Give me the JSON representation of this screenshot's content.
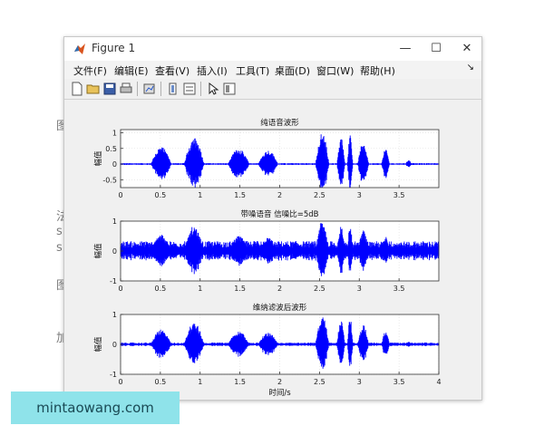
{
  "window": {
    "title": "Figure 1",
    "minimize": "—",
    "maximize": "☐",
    "close": "✕"
  },
  "menu": [
    {
      "id": "file",
      "label": "文件(F)"
    },
    {
      "id": "edit",
      "label": "编辑(E)"
    },
    {
      "id": "view",
      "label": "查看(V)"
    },
    {
      "id": "insert",
      "label": "插入(I)"
    },
    {
      "id": "tools",
      "label": "工具(T)"
    },
    {
      "id": "desktop",
      "label": "桌面(D)"
    },
    {
      "id": "window",
      "label": "窗口(W)"
    },
    {
      "id": "help",
      "label": "帮助(H)"
    }
  ],
  "menu_arrow": "↘",
  "toolbar": {
    "buttons": [
      "new-figure-icon",
      "open-folder-icon",
      "save-icon",
      "print-icon",
      "link-plot-icon",
      "colorbar-icon",
      "legend-icon",
      "pointer-icon",
      "property-inspector-icon"
    ]
  },
  "background_fragments": [
    "图",
    "法",
    "s",
    "s",
    "图",
    "加"
  ],
  "watermark": "mintaowang.com",
  "colors": {
    "signal": "#0000ff",
    "axes": "#333333",
    "grid": "#dddddd",
    "plot_bg": "#ffffff",
    "figure_bg": "#f0f0f0"
  },
  "chart_data": [
    {
      "type": "line",
      "title": "纯语音波形",
      "xlabel": "",
      "ylabel": "幅值",
      "xlim": [
        0,
        4
      ],
      "ylim": [
        -0.75,
        1.1
      ],
      "xticks": [
        0,
        0.5,
        1,
        1.5,
        2,
        2.5,
        3,
        3.5
      ],
      "xtick_labels": [
        "0",
        "0.5",
        "1",
        "1.5",
        "2",
        "2.5",
        "3",
        "3.5"
      ],
      "yticks": [
        -0.5,
        0,
        0.5,
        1
      ],
      "ytick_labels": [
        "-0.5",
        "0",
        "0.5",
        "1"
      ],
      "noise_floor": 0.02,
      "segments": [
        {
          "x": [
            0.38,
            0.64
          ],
          "amp": 0.55
        },
        {
          "x": [
            0.8,
            1.05
          ],
          "amp": 0.85
        },
        {
          "x": [
            1.35,
            1.62
          ],
          "amp": 0.5
        },
        {
          "x": [
            1.73,
            1.98
          ],
          "amp": 0.45
        },
        {
          "x": [
            2.45,
            2.62
          ],
          "amp": 1.0
        },
        {
          "x": [
            2.72,
            2.82
          ],
          "amp": 0.85
        },
        {
          "x": [
            2.85,
            2.92
          ],
          "amp": 0.95
        },
        {
          "x": [
            2.98,
            3.12
          ],
          "amp": 0.7
        },
        {
          "x": [
            3.28,
            3.38
          ],
          "amp": 0.5
        },
        {
          "x": [
            3.58,
            3.66
          ],
          "amp": 0.12
        }
      ]
    },
    {
      "type": "line",
      "title": "带噪语音 信噪比=5dB",
      "xlabel": "",
      "ylabel": "幅值",
      "xlim": [
        0,
        4
      ],
      "ylim": [
        -1,
        1
      ],
      "xticks": [
        0,
        0.5,
        1,
        1.5,
        2,
        2.5,
        3,
        3.5
      ],
      "xtick_labels": [
        "0",
        "0.5",
        "1",
        "1.5",
        "2",
        "2.5",
        "3",
        "3.5"
      ],
      "yticks": [
        -1,
        0,
        1
      ],
      "ytick_labels": [
        "-1",
        "0",
        "1"
      ],
      "noise_floor": 0.22,
      "segments": [
        {
          "x": [
            0.38,
            0.64
          ],
          "amp": 0.55
        },
        {
          "x": [
            0.8,
            1.05
          ],
          "amp": 0.85
        },
        {
          "x": [
            1.35,
            1.62
          ],
          "amp": 0.5
        },
        {
          "x": [
            1.73,
            1.98
          ],
          "amp": 0.45
        },
        {
          "x": [
            2.45,
            2.62
          ],
          "amp": 1.0
        },
        {
          "x": [
            2.72,
            2.82
          ],
          "amp": 0.85
        },
        {
          "x": [
            2.85,
            2.92
          ],
          "amp": 0.95
        },
        {
          "x": [
            2.98,
            3.12
          ],
          "amp": 0.7
        },
        {
          "x": [
            3.28,
            3.38
          ],
          "amp": 0.5
        },
        {
          "x": [
            3.58,
            3.66
          ],
          "amp": 0.12
        }
      ]
    },
    {
      "type": "line",
      "title": "维纳滤波后波形",
      "xlabel": "时间/s",
      "ylabel": "幅值",
      "xlim": [
        0,
        4
      ],
      "ylim": [
        -1,
        1
      ],
      "xticks": [
        0,
        0.5,
        1,
        1.5,
        2,
        2.5,
        3,
        3.5,
        4
      ],
      "xtick_labels": [
        "0",
        "0.5",
        "1",
        "1.5",
        "2",
        "2.5",
        "3",
        "3.5",
        "4"
      ],
      "yticks": [
        -1,
        0,
        1
      ],
      "ytick_labels": [
        "-1",
        "0",
        "1"
      ],
      "noise_floor": 0.04,
      "segments": [
        {
          "x": [
            0.38,
            0.64
          ],
          "amp": 0.5
        },
        {
          "x": [
            0.8,
            1.05
          ],
          "amp": 0.75
        },
        {
          "x": [
            1.35,
            1.62
          ],
          "amp": 0.45
        },
        {
          "x": [
            1.73,
            1.98
          ],
          "amp": 0.4
        },
        {
          "x": [
            2.45,
            2.62
          ],
          "amp": 0.95
        },
        {
          "x": [
            2.72,
            2.82
          ],
          "amp": 0.8
        },
        {
          "x": [
            2.85,
            2.92
          ],
          "amp": 0.9
        },
        {
          "x": [
            2.98,
            3.12
          ],
          "amp": 0.65
        },
        {
          "x": [
            3.28,
            3.38
          ],
          "amp": 0.45
        },
        {
          "x": [
            3.58,
            3.66
          ],
          "amp": 0.1
        }
      ]
    }
  ]
}
